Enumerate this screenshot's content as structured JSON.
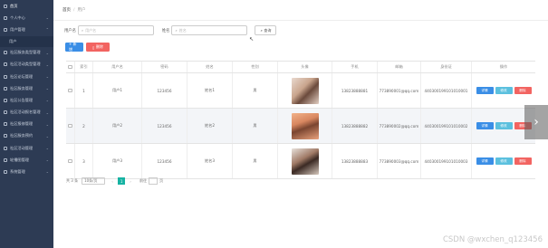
{
  "sidebar": {
    "items": [
      {
        "label": "首页",
        "active": true,
        "has_chevron": false
      },
      {
        "label": "个人中心",
        "has_chevron": true
      },
      {
        "label": "用户管理",
        "has_chevron": true
      },
      {
        "label": "用户",
        "sub": true
      },
      {
        "label": "社区服务类型管理",
        "has_chevron": true
      },
      {
        "label": "社区活动类型管理",
        "has_chevron": true
      },
      {
        "label": "社区论坛管理",
        "has_chevron": true
      },
      {
        "label": "社区服务管理",
        "has_chevron": true
      },
      {
        "label": "社区公告管理",
        "has_chevron": true
      },
      {
        "label": "社区活动报名管理",
        "has_chevron": true
      },
      {
        "label": "社区报修管理",
        "has_chevron": true
      },
      {
        "label": "社区服务预约",
        "has_chevron": true
      },
      {
        "label": "社区活动管理",
        "has_chevron": true
      },
      {
        "label": "轮播图管理",
        "has_chevron": true
      },
      {
        "label": "系统管理",
        "has_chevron": true
      }
    ]
  },
  "breadcrumb": {
    "home": "首页",
    "separator": "/",
    "current": "用户"
  },
  "filters": {
    "account_label": "用户名",
    "account_placeholder": "用户名",
    "name_label": "姓名",
    "name_placeholder": "姓名",
    "query_label": "查询"
  },
  "actions": {
    "add_label": "+ 新增",
    "delete_label": "删除"
  },
  "table": {
    "headers": [
      "",
      "索引",
      "用户名",
      "密码",
      "姓名",
      "性别",
      "头像",
      "手机",
      "邮箱",
      "身份证",
      "操作"
    ],
    "rows": [
      {
        "index": "1",
        "account": "用户1",
        "password": "123456",
        "name": "姓名1",
        "gender": "男",
        "phone": "13823888881",
        "email": "773890001@qq.com",
        "idcard": "440300199101010001"
      },
      {
        "index": "2",
        "account": "用户2",
        "password": "123456",
        "name": "姓名2",
        "gender": "男",
        "phone": "13823888882",
        "email": "773890002@qq.com",
        "idcard": "440300199101010002"
      },
      {
        "index": "3",
        "account": "用户3",
        "password": "123456",
        "name": "姓名3",
        "gender": "男",
        "phone": "13823888883",
        "email": "773890003@qq.com",
        "idcard": "440300199101010003"
      }
    ],
    "op_detail": "详情",
    "op_edit": "修改",
    "op_delete": "删除"
  },
  "pager": {
    "total": "共 3 条",
    "page_size": "10条/页",
    "prev": "‹",
    "current": "1",
    "next": "›",
    "goto": "前往",
    "page_unit": "页"
  },
  "watermark": "CSDN @wxchen_q123456",
  "colors": {
    "sidebar_bg": "#2d3b54",
    "primary": "#3a8ee6",
    "danger": "#f26461",
    "info": "#5bc0de",
    "pager_active": "#17b3a3"
  }
}
